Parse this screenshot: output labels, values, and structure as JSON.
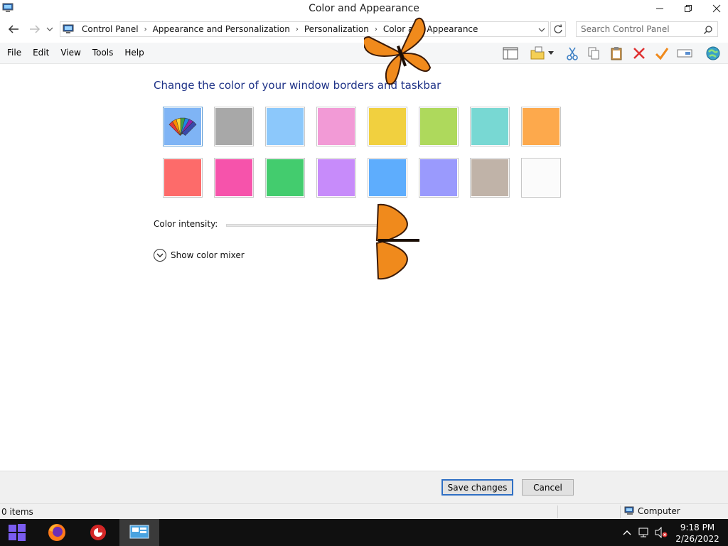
{
  "window": {
    "title": "Color and Appearance"
  },
  "address": {
    "breadcrumbs": [
      "Control Panel",
      "Appearance and Personalization",
      "Personalization",
      "Color and Appearance"
    ]
  },
  "search": {
    "placeholder": "Search Control Panel"
  },
  "menu": {
    "items": [
      "File",
      "Edit",
      "View",
      "Tools",
      "Help"
    ]
  },
  "content": {
    "heading": "Change the color of your window borders and taskbar",
    "swatches_row1": [
      "#7fb4f5",
      "#a8a8a8",
      "#8cc8fb",
      "#f29ad6",
      "#f1d03f",
      "#aed95c",
      "#78d8d3",
      "#fda94c"
    ],
    "swatches_row2": [
      "#fd6b6a",
      "#f653ab",
      "#43cc6e",
      "#c78bfa",
      "#5eadfd",
      "#9a9afd",
      "#c0b3a8",
      "#fbfbfb"
    ],
    "intensity_label": "Color intensity:",
    "mixer_label": "Show color mixer"
  },
  "buttons": {
    "save": "Save changes",
    "cancel": "Cancel"
  },
  "status": {
    "items": "0 items",
    "location": "Computer"
  },
  "taskbar": {
    "time": "9:18 PM",
    "date": "2/26/2022"
  },
  "colors": {
    "heading": "#1e3287",
    "taskbar": "#101010",
    "accent": "#2f6fc4",
    "windows_logo": "#7a5cf0"
  },
  "icons": [
    "back-arrow-icon",
    "forward-arrow-icon",
    "computer-icon",
    "refresh-icon",
    "search-icon",
    "minimize-icon",
    "maximize-icon",
    "close-icon",
    "layout-icon",
    "new-folder-icon",
    "cut-icon",
    "copy-icon",
    "paste-icon",
    "delete-icon",
    "checkmark-icon",
    "rename-icon",
    "globe-icon",
    "color-palette-icon",
    "chevron-down-icon",
    "butterfly-icon",
    "windows-logo-icon",
    "firefox-icon",
    "cleaner-icon",
    "control-panel-icon",
    "network-icon",
    "volume-muted-icon",
    "chevron-up-icon"
  ]
}
